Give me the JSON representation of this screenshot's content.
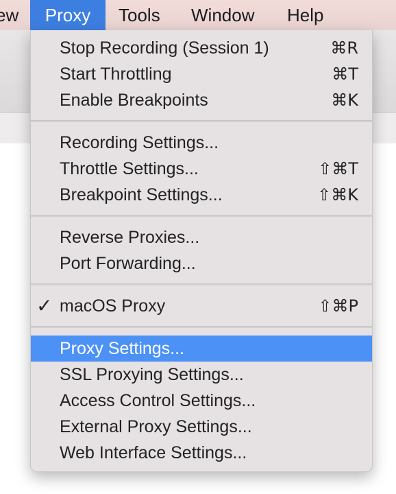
{
  "menubar": {
    "partial_label": "ew",
    "items": [
      "Proxy",
      "Tools",
      "Window",
      "Help"
    ]
  },
  "menu": {
    "groups": [
      [
        {
          "label": "Stop Recording (Session 1)",
          "shortcut": "⌘R"
        },
        {
          "label": "Start Throttling",
          "shortcut": "⌘T"
        },
        {
          "label": "Enable Breakpoints",
          "shortcut": "⌘K"
        }
      ],
      [
        {
          "label": "Recording Settings...",
          "shortcut": ""
        },
        {
          "label": "Throttle Settings...",
          "shortcut": "⇧⌘T"
        },
        {
          "label": "Breakpoint Settings...",
          "shortcut": "⇧⌘K"
        }
      ],
      [
        {
          "label": "Reverse Proxies...",
          "shortcut": ""
        },
        {
          "label": "Port Forwarding...",
          "shortcut": ""
        }
      ],
      [
        {
          "label": "macOS Proxy",
          "shortcut": "⇧⌘P",
          "checked": true,
          "check_mark": "✓"
        }
      ],
      [
        {
          "label": "Proxy Settings...",
          "shortcut": "",
          "highlighted": true
        },
        {
          "label": "SSL Proxying Settings...",
          "shortcut": ""
        },
        {
          "label": "Access Control Settings...",
          "shortcut": ""
        },
        {
          "label": "External Proxy Settings...",
          "shortcut": ""
        },
        {
          "label": "Web Interface Settings...",
          "shortcut": ""
        }
      ]
    ]
  },
  "colors": {
    "highlight": "#4c91f5",
    "menubar_selected": "#3d7fe0",
    "menu_background": "#e6e2e3",
    "menubar_background": "#f1dcd9"
  }
}
